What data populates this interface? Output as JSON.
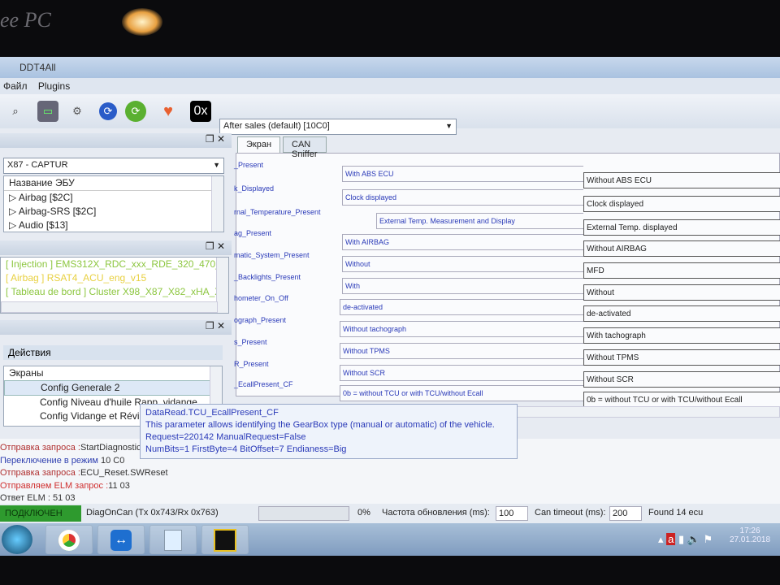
{
  "window": {
    "title": "DDT4All",
    "brand": "ee PC"
  },
  "menu": [
    "Файл",
    "Plugins"
  ],
  "toolbar": {
    "icons": [
      "scan-ecu-icon",
      "monitor-icon",
      "settings-bot-icon",
      "refresh-blue-icon",
      "refresh-green-icon",
      "heart-monitor-icon",
      "hex-icon"
    ],
    "hex_label": "0x",
    "session": "After sales (default) [10C0]"
  },
  "vehicle": {
    "selected": "X87 - CAPTUR"
  },
  "ecu_list": {
    "header": "Название ЭБУ",
    "items": [
      "Airbag [$2C]",
      "Airbag-SRS [$2C]",
      "Audio [$13]"
    ]
  },
  "found_ecus": [
    {
      "text": "[ Injection ] EMS312X_RDC_xxx_RDE_320_470_5A",
      "color": "#8cc63f"
    },
    {
      "text": "[ Airbag ] RSAT4_ACU_eng_v15",
      "color": "#e8d040"
    },
    {
      "text": "[ Tableau de bord ] Cluster X98_X87_X82_xHA_X",
      "color": "#8cc63f"
    }
  ],
  "actions": {
    "header": "Действия",
    "group": "Экраны",
    "items": [
      "Config Generale 2",
      "Config Niveau d'huile Rapp. vidange",
      "Config Vidange et Révision"
    ],
    "selected": 0
  },
  "tabs": [
    "Экран",
    "CAN Sniffer"
  ],
  "params": [
    {
      "label": "_Present",
      "left": "With ABS ECU",
      "right": "Without ABS ECU"
    },
    {
      "label": "k_Displayed",
      "left": "Clock displayed",
      "right": "Clock displayed"
    },
    {
      "label": "rnal_Temperature_Present",
      "left": "External Temp. Measurement and Display",
      "right": "External Temp. displayed"
    },
    {
      "label": "ag_Present",
      "left": "With AIRBAG",
      "right": "Without AIRBAG"
    },
    {
      "label": "matic_System_Present",
      "left": "Without",
      "right": "MFD"
    },
    {
      "label": "_Backlights_Present",
      "left": "With",
      "right": "Without"
    },
    {
      "label": "hometer_On_Off",
      "left": "de-activated",
      "right": "de-activated"
    },
    {
      "label": "ograph_Present",
      "left": "Without tachograph",
      "right": "With tachograph"
    },
    {
      "label": "s_Present",
      "left": "Without TPMS",
      "right": "Without TPMS"
    },
    {
      "label": "R_Present",
      "left": "Without SCR",
      "right": "Without SCR"
    },
    {
      "label": "_EcallPresent_CF",
      "left": "0b = without TCU or with TCU/without Ecall",
      "right": "0b = without TCU or with TCU/without Ecall"
    }
  ],
  "tooltip": [
    "DataRead.TCU_EcallPresent_CF",
    "This parameter allows identifying the GearBox type (manual or automatic) of the vehicle.",
    "Request=220142 ManualRequest=False",
    "NumBits=1 FirstByte=4 BitOffset=7 Endianess=Big"
  ],
  "log": [
    {
      "prefix": "Отправка запроса :",
      "text": "StartDiagnosticSession",
      "color": "#b03030"
    },
    {
      "prefix": "Переключение в режим ",
      "text": "10 C0",
      "color": "#3040b0"
    },
    {
      "prefix": "Отправка запроса :",
      "text": "ECU_Reset.SWReset",
      "color": "#b03030"
    },
    {
      "prefix": "Отправляем ELM запрос :",
      "text": "11 03",
      "color": "#d03030"
    },
    {
      "prefix": "Ответ ELM : ",
      "text": "51 03",
      "color": "#333333"
    }
  ],
  "status": {
    "connected": "ПОДКЛЮЧЕН",
    "connected_color": "#2e9a2e",
    "protocol": "DiagOnCan (Tx 0x743/Rx 0x763)",
    "progress_percent": 0,
    "progress_label": "0%",
    "refresh_label": "Частота обновления (ms):",
    "refresh_value": "100",
    "timeout_label": "Can timeout (ms):",
    "timeout_value": "200",
    "found": "Found 14 ecu"
  },
  "taskbar": {
    "apps": [
      "windows-start-icon",
      "chrome-icon",
      "teamviewer-icon",
      "notepad-icon",
      "obd-check-icon"
    ],
    "time": "17:26",
    "date": "27.01.2018"
  }
}
